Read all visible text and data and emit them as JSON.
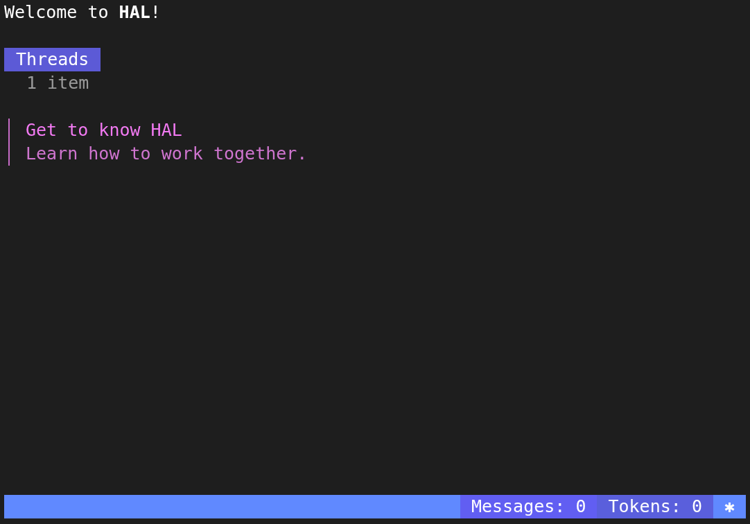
{
  "greeting": "Welcome to **HAL**!",
  "section": {
    "title": "Threads",
    "count": "1 item"
  },
  "threads": [
    {
      "title": "Get to know HAL",
      "description": "Learn how to work together.",
      "selected": true
    }
  ],
  "status_bar": [
    {
      "kind": "messages",
      "text": "Messages: 0"
    },
    {
      "kind": "tokens",
      "text": "Tokens: 0"
    },
    {
      "kind": "indicator",
      "text": "✱"
    }
  ]
}
